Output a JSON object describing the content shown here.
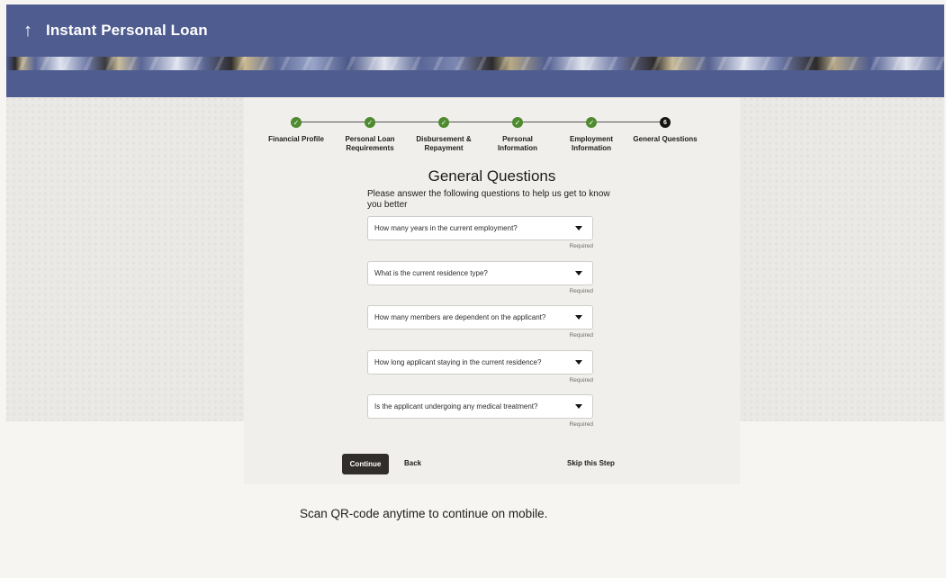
{
  "header": {
    "back_icon": "up-arrow-icon",
    "title": "Instant Personal Loan"
  },
  "stepper": {
    "steps": [
      {
        "label": "Financial Profile",
        "status": "done"
      },
      {
        "label": "Personal Loan Requirements",
        "status": "done"
      },
      {
        "label": "Disbursement & Repayment",
        "status": "done"
      },
      {
        "label": "Personal Information",
        "status": "done"
      },
      {
        "label": "Employment Information",
        "status": "done"
      },
      {
        "label": "General Questions",
        "status": "current",
        "number": "6"
      }
    ]
  },
  "main": {
    "title": "General Questions",
    "intro": "Please answer the following questions to help us get to know you better",
    "questions": [
      {
        "placeholder": "How many years in the current employment?",
        "hint": "Required"
      },
      {
        "placeholder": "What is the current residence type?",
        "hint": "Required"
      },
      {
        "placeholder": "How many members are dependent on the applicant?",
        "hint": "Required"
      },
      {
        "placeholder": "How long applicant staying in the current residence?",
        "hint": "Required"
      },
      {
        "placeholder": "Is the applicant undergoing any medical treatment?",
        "hint": "Required"
      }
    ]
  },
  "actions": {
    "continue_label": "Continue",
    "back_label": "Back",
    "skip_label": "Skip this Step"
  },
  "footer": {
    "qr_note": "Scan QR-code anytime to continue on mobile."
  },
  "colors": {
    "header_bg": "#4f5c8f",
    "step_done": "#4e8a2f",
    "step_current": "#161513",
    "button_primary": "#312d2a"
  }
}
